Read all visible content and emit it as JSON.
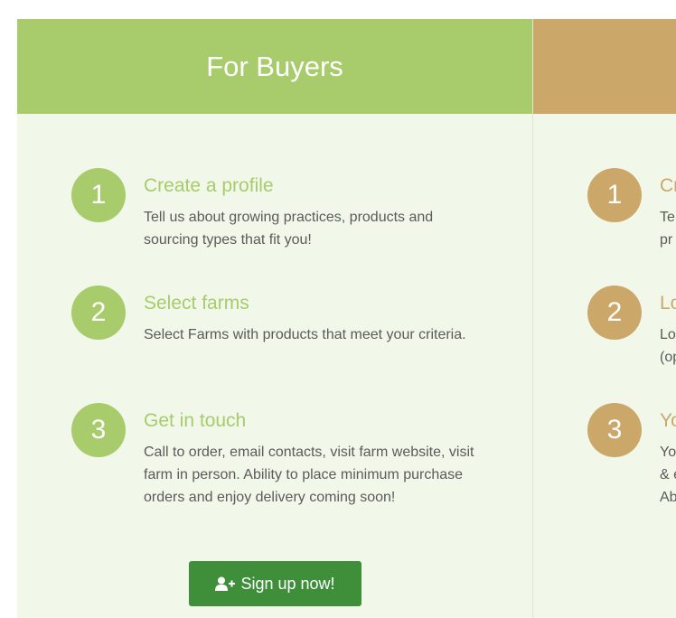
{
  "buyers": {
    "header": "For Buyers",
    "steps": [
      {
        "num": "1",
        "title": "Create a profile",
        "desc": "Tell us about growing practices, products and sourcing types that fit you!"
      },
      {
        "num": "2",
        "title": "Select farms",
        "desc": "Select Farms with products that meet your criteria."
      },
      {
        "num": "3",
        "title": "Get in touch",
        "desc": "Call to order, email contacts, visit farm website, visit farm in person. Ability to place minimum purchase orders and enjoy delivery coming soon!"
      }
    ],
    "signup_label": "Sign up now!"
  },
  "farmers": {
    "header": "",
    "steps": [
      {
        "num": "1",
        "title": "Cr",
        "desc_line1": "Te",
        "desc_line2": "pr"
      },
      {
        "num": "2",
        "title": "Lo",
        "desc_line1": "Lo",
        "desc_line2": "(op"
      },
      {
        "num": "3",
        "title": "Yo",
        "desc_line1": "You",
        "desc_line2": "& e",
        "desc_line3": "Ab"
      }
    ]
  },
  "colors": {
    "buyers_accent": "#a8cb6b",
    "farmers_accent": "#cba86a",
    "panel_bg": "#f1f8e9",
    "button_bg": "#3e8e3a"
  },
  "icons": {
    "signup": "user-plus-icon"
  }
}
